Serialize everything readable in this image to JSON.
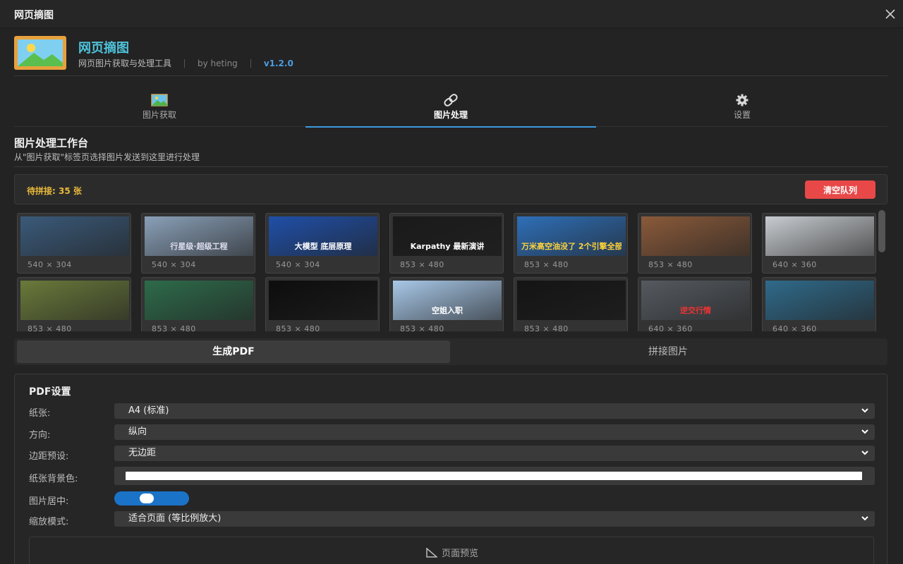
{
  "window": {
    "title": "网页摘图"
  },
  "header": {
    "app_name": "网页摘图",
    "tagline": "网页图片获取与处理工具",
    "author": "by heting",
    "version": "v1.2.0"
  },
  "tabs": [
    {
      "label": "图片获取",
      "icon": "image-icon"
    },
    {
      "label": "图片处理",
      "icon": "link-icon",
      "active": true
    },
    {
      "label": "设置",
      "icon": "gear-icon"
    }
  ],
  "workspace": {
    "title": "图片处理工作台",
    "subtitle": "从\"图片获取\"标签页选择图片发送到这里进行处理",
    "queue_count": "待拼接: 35 张",
    "clear_label": "清空队列"
  },
  "thumbnails": [
    {
      "dim": "540 × 304",
      "caption": ""
    },
    {
      "dim": "540 × 304",
      "caption": "行星级·超级工程"
    },
    {
      "dim": "540 × 304",
      "caption": "大模型 底层原理"
    },
    {
      "dim": "853 × 480",
      "caption": "Karpathy 最新演讲"
    },
    {
      "dim": "853 × 480",
      "caption": "万米高空油没了 2个引擎全部熄火"
    },
    {
      "dim": "853 × 480",
      "caption": ""
    },
    {
      "dim": "640 × 360",
      "caption": ""
    },
    {
      "dim": "853 × 480",
      "caption": ""
    },
    {
      "dim": "853 × 480",
      "caption": ""
    },
    {
      "dim": "853 × 480",
      "caption": ""
    },
    {
      "dim": "853 × 480",
      "caption": "空姐入职"
    },
    {
      "dim": "853 × 480",
      "caption": ""
    },
    {
      "dim": "640 × 360",
      "caption": "逆交行情"
    },
    {
      "dim": "640 × 360",
      "caption": ""
    }
  ],
  "modes": [
    {
      "label": "生成PDF",
      "active": true
    },
    {
      "label": "拼接图片"
    }
  ],
  "pdf": {
    "title": "PDF设置",
    "paper_label": "纸张:",
    "paper_value": "A4 (标准)",
    "orientation_label": "方向:",
    "orientation_value": "纵向",
    "margin_label": "边距预设:",
    "margin_value": "无边距",
    "bg_label": "纸张背景色:",
    "bg_color": "#ffffff",
    "center_label": "图片居中:",
    "center_on": true,
    "scale_label": "缩放模式:",
    "scale_value": "适合页面 (等比例放大)",
    "preview_label": "页面预览"
  }
}
